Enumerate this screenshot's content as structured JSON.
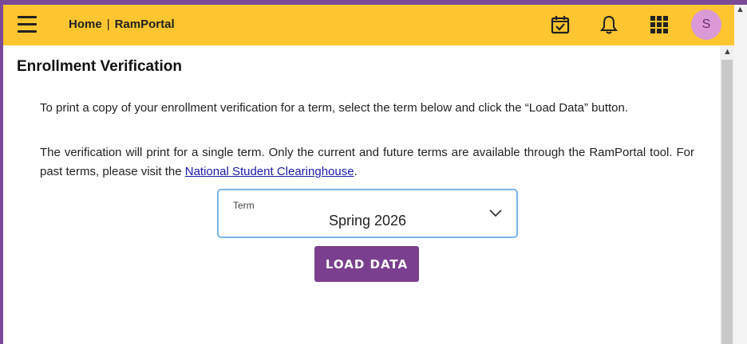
{
  "header": {
    "breadcrumb_home": "Home",
    "breadcrumb_separator": "|",
    "breadcrumb_current": "RamPortal",
    "icons": [
      "menu-icon",
      "calendar-check-icon",
      "bell-icon",
      "apps-grid-icon"
    ],
    "avatar_initial": "S",
    "bar_color": "#fdc52f"
  },
  "main": {
    "title": "Enrollment Verification",
    "paragraph1": "To print a copy of your enrollment verification for a term, select the term below and click the “Load Data” button.",
    "paragraph2_text": "The verification will print for a single term. Only the current and future terms are available through the RamPortal tool. For past terms, please visit the ",
    "paragraph2_link": "National Student Clearinghouse",
    "paragraph2_end": ".",
    "term_select": {
      "label": "Term",
      "value": "Spring 2026"
    },
    "load_button_label": "LOAD DATA",
    "button_color": "#7a3f8f"
  }
}
